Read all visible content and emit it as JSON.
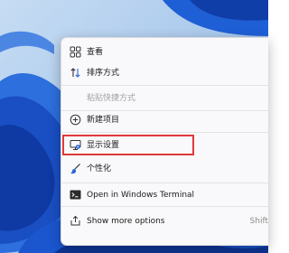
{
  "context_menu": {
    "items": [
      {
        "label": "查看",
        "icon": "grid-view-icon"
      },
      {
        "label": "排序方式",
        "icon": "sort-arrows-icon"
      },
      {
        "label": "粘贴快捷方式",
        "icon": "",
        "disabled": true
      },
      {
        "label": "新建项目",
        "icon": "plus-circle-icon"
      },
      {
        "label": "显示设置",
        "icon": "display-settings-icon",
        "highlighted": true
      },
      {
        "label": "个性化",
        "icon": "brush-icon"
      },
      {
        "label": "Open in Windows Terminal",
        "icon": "terminal-icon"
      },
      {
        "label": "Show more options",
        "icon": "share-icon",
        "shortcut": "Shift"
      }
    ]
  },
  "colors": {
    "wallpaper_light": "#a9c9ee",
    "wallpaper_blue": "#1f5fd6",
    "menu_background": "#f9f9fb",
    "highlight_border": "#e0383b",
    "disabled_text": "#a3a3a3"
  }
}
